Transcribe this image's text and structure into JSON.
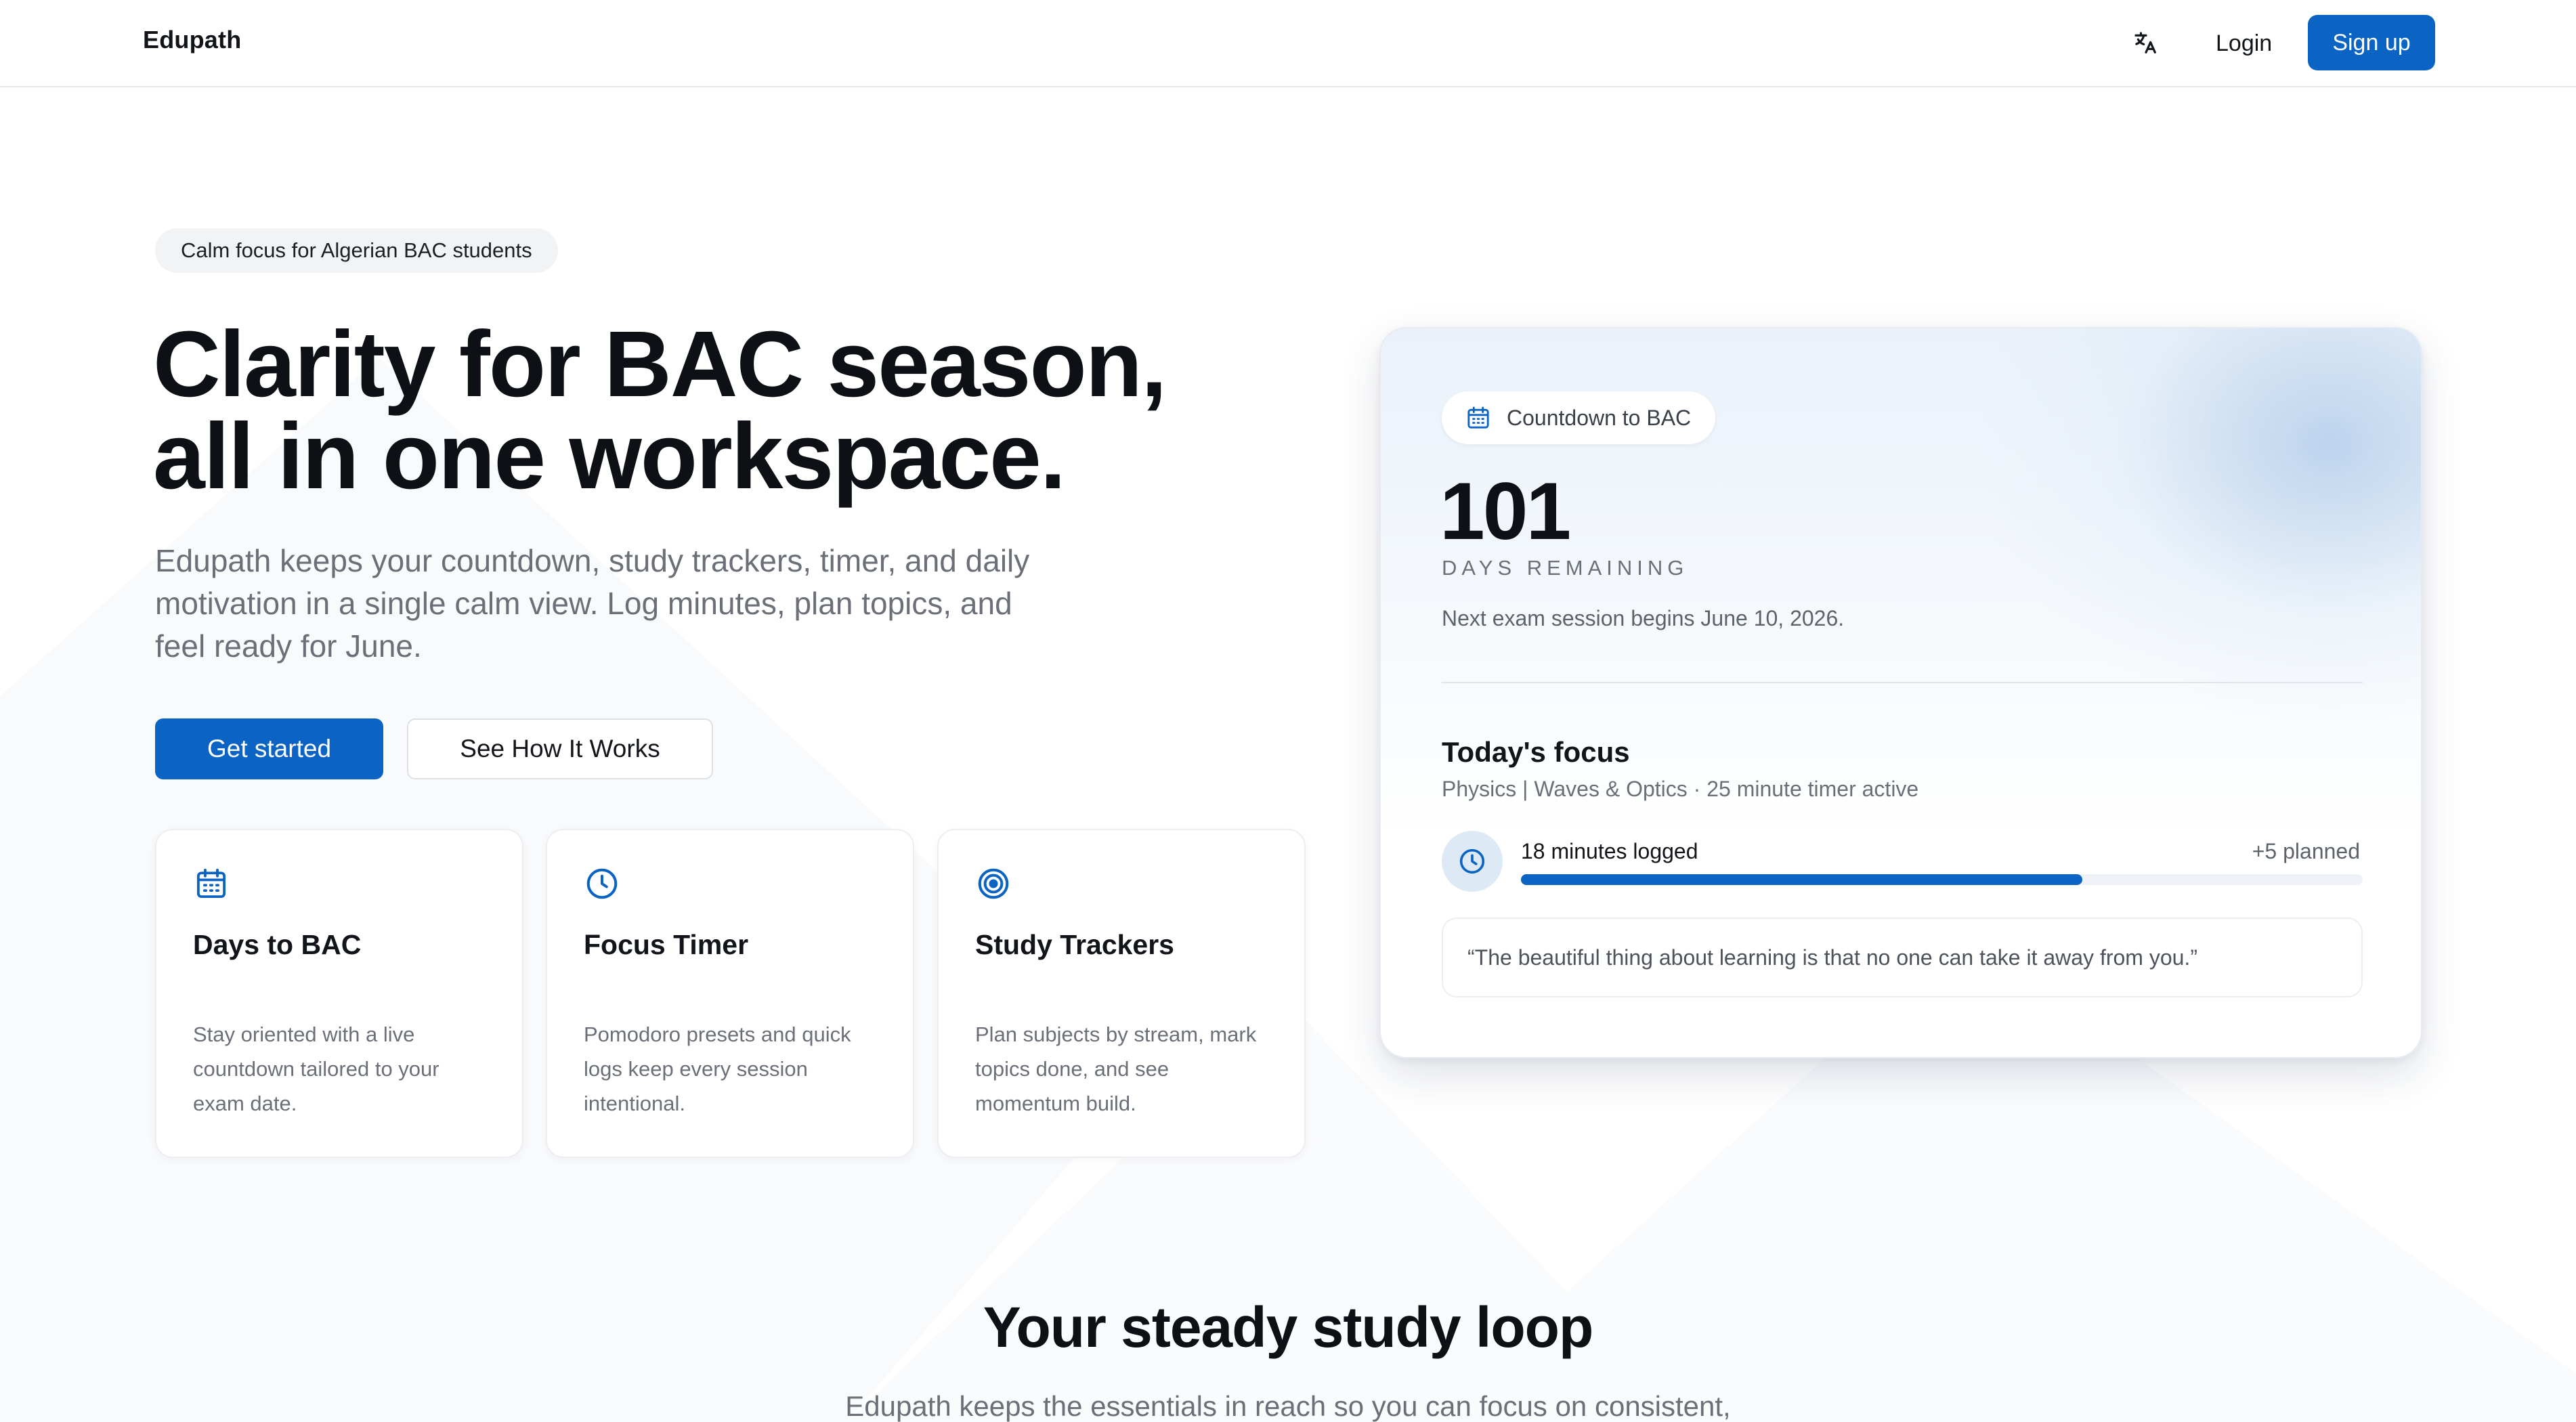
{
  "header": {
    "brand": "Edupath",
    "language_icon": "translate-icon",
    "login_label": "Login",
    "signup_label": "Sign up"
  },
  "hero": {
    "pill": "Calm focus for Algerian BAC students",
    "title_line1": "Clarity for BAC season,",
    "title_line2": "all in one workspace.",
    "subtitle": "Edupath keeps your countdown, study trackers, timer, and daily motivation in a single calm view. Log minutes, plan topics, and feel ready for June.",
    "cta_primary": "Get started",
    "cta_secondary": "See How It Works"
  },
  "features": [
    {
      "icon": "calendar-icon",
      "title": "Days to BAC",
      "description": "Stay oriented with a live countdown tailored to your exam date."
    },
    {
      "icon": "clock-icon",
      "title": "Focus Timer",
      "description": "Pomodoro presets and quick logs keep every session intentional."
    },
    {
      "icon": "target-icon",
      "title": "Study Trackers",
      "description": "Plan subjects by stream, mark topics done, and see momentum build."
    }
  ],
  "countdown_card": {
    "chip_label": "Countdown to BAC",
    "chip_icon": "calendar-icon",
    "days": "101",
    "days_label": "DAYS REMAINING",
    "next_session": "Next exam session begins June 10, 2026.",
    "focus_title": "Today's focus",
    "focus_subtitle": "Physics | Waves & Optics · 25 minute timer active",
    "logged_label": "18 minutes logged",
    "planned_label": "+5 planned",
    "progress_fraction": 0.667,
    "quote": "“The beautiful thing about learning is that no one can take it away from you.”"
  },
  "loop_section": {
    "title": "Your steady study loop",
    "subtitle": "Edupath keeps the essentials in reach so you can focus on consistent,"
  },
  "colors": {
    "accent": "#0b63c4",
    "text": "#111418",
    "muted": "#6b7078"
  }
}
